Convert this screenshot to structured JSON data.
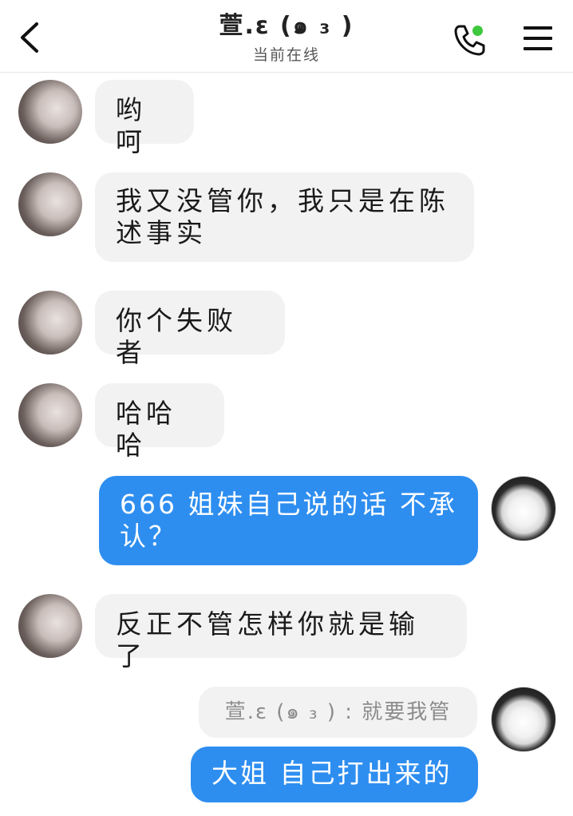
{
  "header": {
    "title": "萱.ɛ (๑ ₃ )",
    "status": "当前在线",
    "online_color": "#3ec83e"
  },
  "messages": [
    {
      "side": "in",
      "text": "哟呵"
    },
    {
      "side": "in",
      "text": "我又没管你，我只是在陈述事实"
    },
    {
      "side": "in",
      "text": "你个失败者"
    },
    {
      "side": "in",
      "text": "哈哈哈"
    },
    {
      "side": "out",
      "text": "666 姐妹自己说的话 不承认？"
    },
    {
      "side": "in",
      "text": "反正不管怎样你就是输了"
    },
    {
      "side": "out",
      "quote": "萱.ɛ (๑ ₃ ) : 就要我管",
      "text": "大姐 自己打出来的"
    }
  ],
  "icons": {
    "back": "chevron-left-icon",
    "call": "phone-icon",
    "menu": "hamburger-menu-icon"
  },
  "colors": {
    "out_bubble": "#2e8ef0",
    "in_bubble": "#f2f2f2"
  }
}
